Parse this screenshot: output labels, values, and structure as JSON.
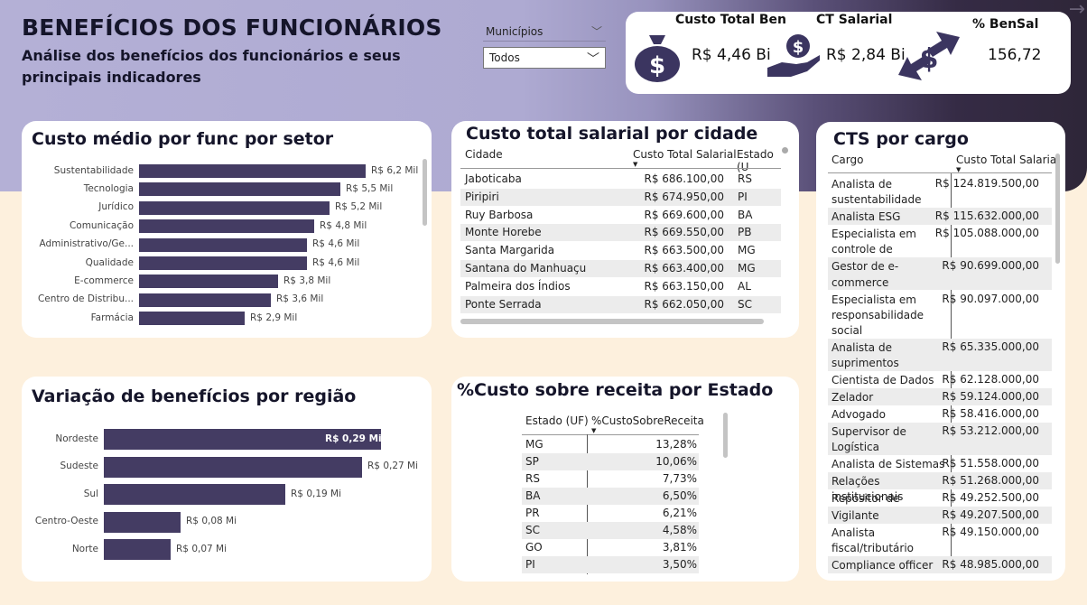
{
  "header": {
    "title": "BENEFÍCIOS DOS FUNCIONÁRIOS",
    "subtitle": "Análise dos benefícios dos funcionários e seus principais indicadores"
  },
  "slicer": {
    "label": "Municípios",
    "value": "Todos"
  },
  "kpis": [
    {
      "label": "Custo Total Ben",
      "value": "R$ 4,46 Bi",
      "icon": "money-bag-icon"
    },
    {
      "label": "CT Salarial",
      "value": "R$ 2,84 Bi",
      "icon": "hand-coin-icon"
    },
    {
      "label": "% BenSal",
      "value": "156,72",
      "icon": "exchange-dollar-icon"
    }
  ],
  "sector_chart": {
    "title": "Custo médio por func por setor",
    "chart_data": {
      "type": "bar",
      "categories": [
        "Sustentabilidade",
        "Tecnologia",
        "Jurídico",
        "Comunicação",
        "Administrativo/Ge...",
        "Qualidade",
        "E-commerce",
        "Centro de Distribu...",
        "Farmácia"
      ],
      "values": [
        6.2,
        5.5,
        5.2,
        4.8,
        4.6,
        4.6,
        3.8,
        3.6,
        2.9
      ],
      "labels": [
        "R$ 6,2 Mil",
        "R$ 5,5 Mil",
        "R$ 5,2 Mil",
        "R$ 4,8 Mil",
        "R$ 4,6 Mil",
        "R$ 4,6 Mil",
        "R$ 3,8 Mil",
        "R$ 3,6 Mil",
        "R$ 2,9 Mil"
      ],
      "xmax": 6.2
    }
  },
  "region_chart": {
    "title": "Variação de benefícios por região",
    "chart_data": {
      "type": "bar",
      "categories": [
        "Nordeste",
        "Sudeste",
        "Sul",
        "Centro-Oeste",
        "Norte"
      ],
      "values": [
        0.29,
        0.27,
        0.19,
        0.08,
        0.07
      ],
      "labels": [
        "R$ 0,29 Mi",
        "R$ 0,27 Mi",
        "R$ 0,19 Mi",
        "R$ 0,08 Mi",
        "R$ 0,07 Mi"
      ],
      "xmax": 0.29
    }
  },
  "city_table": {
    "title": "Custo total salarial por cidade",
    "columns": [
      "Cidade",
      "Custo Total Salarial",
      "Estado (U"
    ],
    "rows": [
      [
        "Jaboticaba",
        "R$ 686.100,00",
        "RS"
      ],
      [
        "Piripiri",
        "R$ 674.950,00",
        "PI"
      ],
      [
        "Ruy Barbosa",
        "R$ 669.600,00",
        "BA"
      ],
      [
        "Monte Horebe",
        "R$ 669.550,00",
        "PB"
      ],
      [
        "Santa Margarida",
        "R$ 663.500,00",
        "MG"
      ],
      [
        "Santana do Manhuaçu",
        "R$ 663.400,00",
        "MG"
      ],
      [
        "Palmeira dos Índios",
        "R$ 663.150,00",
        "AL"
      ],
      [
        "Ponte Serrada",
        "R$ 662.050,00",
        "SC"
      ]
    ]
  },
  "state_table": {
    "title": "%Custo sobre receita por Estado",
    "columns": [
      "Estado (UF)",
      "%CustoSobreReceita"
    ],
    "rows": [
      [
        "MG",
        "13,28%"
      ],
      [
        "SP",
        "10,06%"
      ],
      [
        "RS",
        "7,73%"
      ],
      [
        "BA",
        "6,50%"
      ],
      [
        "PR",
        "6,21%"
      ],
      [
        "SC",
        "4,58%"
      ],
      [
        "GO",
        "3,81%"
      ],
      [
        "PI",
        "3,50%"
      ]
    ]
  },
  "cargo_table": {
    "title": "CTS por cargo",
    "columns": [
      "Cargo",
      "Custo Total Salarial"
    ],
    "rows": [
      [
        "Analista de sustentabilidade",
        "R$ 124.819.500,00"
      ],
      [
        "Analista ESG",
        "R$ 115.632.000,00"
      ],
      [
        "Especialista em controle de qualidade",
        "R$ 105.088.000,00"
      ],
      [
        "Gestor de e-commerce",
        "R$ 90.699.000,00"
      ],
      [
        "Especialista em responsabilidade social",
        "R$ 90.097.000,00"
      ],
      [
        "Analista de suprimentos",
        "R$ 65.335.000,00"
      ],
      [
        "Cientista de Dados",
        "R$ 62.128.000,00"
      ],
      [
        "Zelador",
        "R$ 59.124.000,00"
      ],
      [
        "Advogado corporativo",
        "R$ 58.416.000,00"
      ],
      [
        "Supervisor de Logística",
        "R$ 53.212.000,00"
      ],
      [
        "Analista de Sistemas",
        "R$ 51.558.000,00"
      ],
      [
        "Relações institucionais",
        "R$ 51.268.000,00"
      ],
      [
        "Repositor de Hortifruti",
        "R$ 49.252.500,00"
      ],
      [
        "Vigilante",
        "R$ 49.207.500,00"
      ],
      [
        "Analista fiscal/tributário",
        "R$ 49.150.000,00"
      ],
      [
        "Compliance officer",
        "R$ 48.985.000,00"
      ]
    ]
  },
  "colors": {
    "bar": "#443c63",
    "header_band": "#b4b0d6",
    "background": "#fdf0dd",
    "icon": "#3b3560"
  }
}
